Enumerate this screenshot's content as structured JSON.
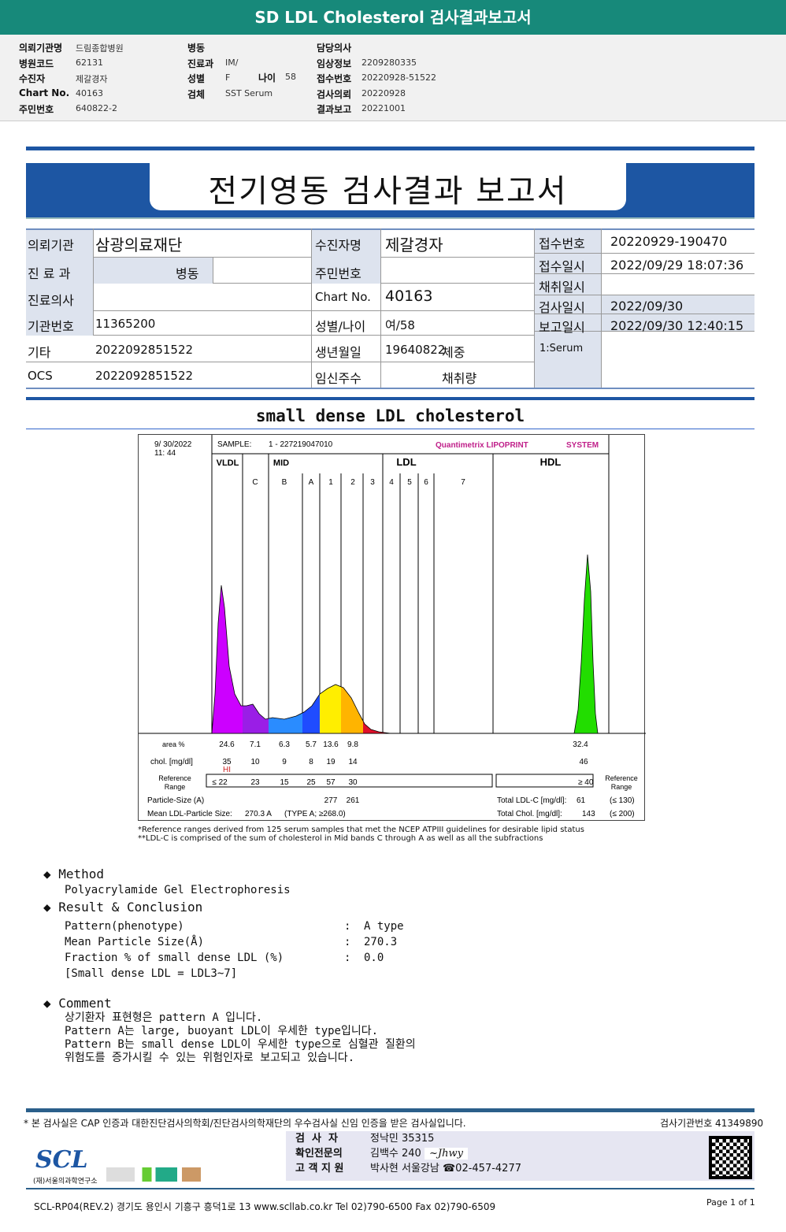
{
  "header": {
    "title": "SD LDL Cholesterol 검사결과보고서"
  },
  "info": {
    "c1": [
      [
        "의뢰기관명",
        "드림종합병원"
      ],
      [
        "병원코드",
        "62131"
      ],
      [
        "수진자",
        "제갈경자"
      ],
      [
        "Chart No.",
        "40163"
      ],
      [
        "주민번호",
        "640822-2"
      ]
    ],
    "c2": [
      [
        "병동",
        ""
      ],
      [
        "진료과",
        "IM/"
      ],
      [
        "성별",
        "F"
      ],
      [
        "검체",
        "SST Serum"
      ]
    ],
    "age_label": "나이",
    "age": "58",
    "c3": [
      [
        "담당의사",
        ""
      ],
      [
        "임상정보",
        "2209280335"
      ],
      [
        "접수번호",
        "20220928-51522"
      ],
      [
        "검사의뢰",
        "20220928"
      ],
      [
        "결과보고",
        "20221001"
      ]
    ]
  },
  "report": {
    "title": "전기영동 검사결과 보고서",
    "rows": {
      "inst_l": "의뢰기관",
      "inst": "삼광의료재단",
      "patient_l": "수진자명",
      "patient": "제갈경자",
      "recno_l": "접수번호",
      "recno": "20220929-190470",
      "dept_l": "진 료 과",
      "ward_l": "병동",
      "rrn_l": "주민번호",
      "recdt_l": "접수일시",
      "recdt": "2022/09/29 18:07:36",
      "coldt_l": "채취일시",
      "doctor_l": "진료의사",
      "chart_l": "Chart No.",
      "chart": "40163",
      "testdt_l": "검사일시",
      "testdt": "2022/09/30",
      "org_l": "기관번호",
      "org": "11365200",
      "sexage_l": "성별/나이",
      "sexage": "여/58",
      "repdt_l": "보고일시",
      "repdt": "2022/09/30 12:40:15",
      "etc_l": "기타",
      "etc": "2022092851522",
      "dob_l": "생년월일",
      "dob": "19640822",
      "weight_l": "체중",
      "specimen": "1:Serum",
      "ocs_l": "OCS",
      "ocs": "2022092851522",
      "preg_l": "임신주수",
      "vol_l": "채취량"
    }
  },
  "section_title": "small dense LDL cholesterol",
  "chart_data": {
    "type": "area",
    "date": "9/ 30/2022",
    "time": "11: 44",
    "sample_label": "SAMPLE:",
    "sample": "1 - 227219047010",
    "brand": "Quantimetrix LIPOPRINT",
    "brand2": "SYSTEM",
    "groups": [
      "VLDL",
      "MID",
      "LDL",
      "HDL"
    ],
    "bands": [
      "C",
      "B",
      "A",
      "1",
      "2",
      "3",
      "4",
      "5",
      "6",
      "7"
    ],
    "colors": {
      "VLDL": "#cc00ff",
      "C": "#9a1ee6",
      "B": "#2a8cff",
      "A": "#1f4cff",
      "1": "#ffee00",
      "2": "#ffb400",
      "3": "#e0102a",
      "HDL": "#22dd00"
    },
    "rows": {
      "area_label": "area %",
      "area": [
        "24.6",
        "7.1",
        "6.3",
        "5.7",
        "13.6",
        "9.8"
      ],
      "hdl_area": "32.4",
      "chol_label": "chol. [mg/dl]",
      "chol": [
        "35",
        "10",
        "9",
        "8",
        "19",
        "14"
      ],
      "hdl_chol": "46",
      "flag": "HI",
      "ref_label": "Reference Range",
      "ref": [
        "≤ 22",
        "23",
        "15",
        "25",
        "57",
        "30"
      ],
      "hdl_ref": "≥ 40",
      "ps_label": "Particle-Size (A)",
      "ps": [
        "277",
        "261"
      ],
      "mean_label": "Mean LDL-Particle Size:",
      "mean": "270.3 A",
      "mean_type": "(TYPE A; ≥268.0)",
      "ldlc_label": "Total LDL-C [mg/dl]:",
      "ldlc": "61",
      "ldlc_ref": "(≤ 130)",
      "tc_label": "Total Chol. [mg/dl]:",
      "tc": "143",
      "tc_ref": "(≤ 200)"
    },
    "footnote1": "*Reference ranges derived from 125 serum samples that met the NCEP ATPIII guidelines for desirable lipid status",
    "footnote2": "**LDL-C is comprised of the sum of cholesterol in Mid bands C through A as well as all the subfractions"
  },
  "method": {
    "title": "Method",
    "text": "Polyacrylamide Gel Electrophoresis"
  },
  "result": {
    "title": "Result & Conclusion",
    "items": [
      [
        "Pattern(phenotype)",
        ":",
        "A type"
      ],
      [
        "Mean Particle Size(Å)",
        ":",
        "270.3"
      ],
      [
        "Fraction % of small dense LDL (%)",
        ":",
        "0.0"
      ]
    ],
    "note": "[Small dense LDL = LDL3~7]"
  },
  "comment": {
    "title": "Comment",
    "lines": [
      "상기환자 표현형은 pattern A 입니다.",
      "Pattern A는 large, buoyant LDL이 우세한 type입니다.",
      "Pattern B는 small dense LDL이 우세한 type으로 심혈관 질환의",
      "위험도를 증가시킬 수 있는 위험인자로 보고되고 있습니다."
    ]
  },
  "footer": {
    "cert": "* 본 검사실은 CAP 인증과 대한진단검사의학회/진단검사의학재단의 우수검사실 신임 인증을 받은 검사실입니다.",
    "labno": "검사기관번호 41349890",
    "tester_l": "검  사  자",
    "tester": "정낙민 35315",
    "confirm_l": "확인전문의",
    "confirm": "김백수 240",
    "support_l": "고 객 지 원",
    "support": "박사현 서울강남 ☎02-457-4277",
    "logo": "SCL",
    "logo_sub": "(재)서울의과학연구소",
    "address": "SCL-RP04(REV.2)  경기도 용인시 기흥구 흥덕1로 13  www.scllab.co.kr   Tel 02)790-6500   Fax 02)790-6509",
    "page": "Page 1 of 1"
  }
}
